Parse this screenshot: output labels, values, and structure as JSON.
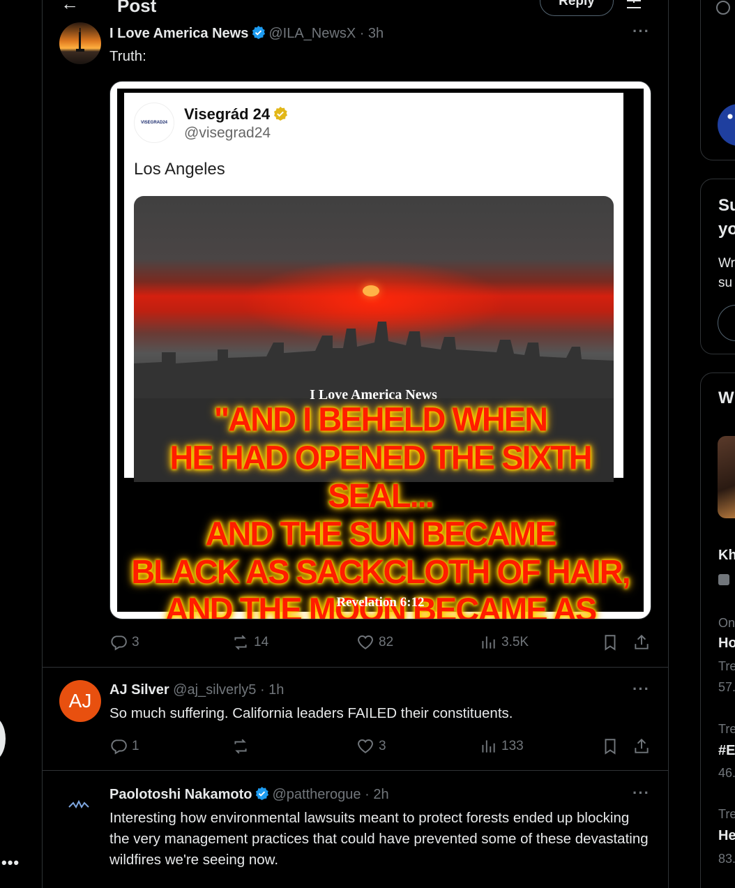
{
  "header": {
    "title": "Post",
    "reply_label": "Reply"
  },
  "main_post": {
    "name": "I Love America News",
    "handle": "@ILA_NewsX",
    "time": "· 3h",
    "text": "Truth:",
    "media": {
      "quoted_name": "Visegrád 24",
      "quoted_handle": "@visegrad24",
      "quoted_logo": "VISEGRAD24",
      "quoted_text": "Los Angeles",
      "brand": "I Love America News",
      "quote_lines": [
        "\"AND I BEHELD WHEN",
        "HE HAD OPENED THE SIXTH SEAL...",
        "AND THE SUN BECAME",
        "BLACK AS SACKCLOTH OF HAIR,",
        "AND THE MOON BECAME AS BLOOD;\""
      ],
      "quote_source": "Revelation 6:12"
    },
    "stats": {
      "replies": "3",
      "reposts": "14",
      "likes": "82",
      "views": "3.5K"
    }
  },
  "replies": [
    {
      "avatar_initials": "AJ",
      "name": "AJ Silver",
      "handle": "@aj_silverly5",
      "time": "· 1h",
      "text": "So much suffering. California leaders FAILED their constituents.",
      "stats": {
        "replies": "1",
        "reposts": "",
        "likes": "3",
        "views": "133"
      }
    },
    {
      "name": "Paolotoshi Nakamoto",
      "handle": "@pattherogue",
      "time": "· 2h",
      "text": "Interesting how environmental lawsuits meant to protect forests ended up blocking the very management practices that could have prevented some of these devastating wildfires we're seeing now."
    }
  ],
  "right_sidebar": {
    "card1_title_a": "Su",
    "card1_title_b": "yo",
    "card1_body_a": "Wr",
    "card1_body_b": "su",
    "card2_title": "W",
    "trend1_title": "Kh",
    "trend2_context": "On",
    "trend2_title": "Ho",
    "trend2_meta": "Tre",
    "trend2_count": "57.",
    "trend3_context": "Tre",
    "trend3_title": "#E",
    "trend3_count": "46.",
    "trend4_context": "Tre",
    "trend4_title": "He",
    "trend4_count": "83."
  },
  "colors": {
    "accent": "#1d9bf0",
    "muted": "#71767b",
    "border": "#2f3336",
    "gold": "#e2b719",
    "avatar_orange": "#e8500f"
  }
}
